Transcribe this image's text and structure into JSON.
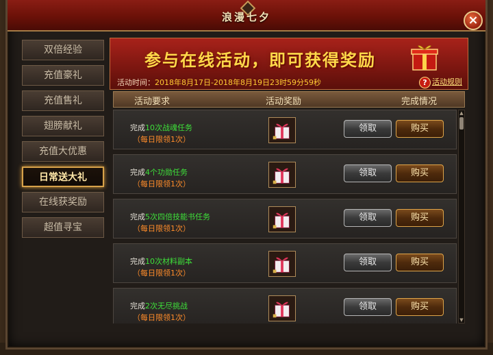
{
  "window": {
    "title": "浪漫七夕",
    "close_label": "×"
  },
  "sidebar": {
    "items": [
      {
        "label": "双倍经验"
      },
      {
        "label": "充值豪礼"
      },
      {
        "label": "充值售礼"
      },
      {
        "label": "翅膀献礼"
      },
      {
        "label": "充值大优惠"
      },
      {
        "label": "日常送大礼",
        "active": true
      },
      {
        "label": "在线获奖励"
      },
      {
        "label": "超值寻宝"
      }
    ]
  },
  "banner": {
    "title": "参与在线活动，即可获得奖励",
    "time_label": "活动时间：",
    "time_value": "2018年8月17日-2018年8月19日23时59分59秒",
    "rules_label": "活动规则",
    "help_symbol": "?"
  },
  "table": {
    "headers": [
      "活动要求",
      "活动奖励",
      "完成情况"
    ],
    "rows": [
      {
        "prefix": "完成",
        "task": "10次战魂任务",
        "limit": "（每日限领1次）",
        "claim": "领取",
        "buy": "购买"
      },
      {
        "prefix": "完成",
        "task": "4个功勋任务",
        "limit": "（每日限领1次）",
        "claim": "领取",
        "buy": "购买"
      },
      {
        "prefix": "完成",
        "task": "5次四倍技能书任务",
        "limit": "（每日限领1次）",
        "claim": "领取",
        "buy": "购买"
      },
      {
        "prefix": "完成",
        "task": "10次材料副本",
        "limit": "（每日限领1次）",
        "claim": "领取",
        "buy": "购买"
      },
      {
        "prefix": "完成",
        "task": "2次无尽挑战",
        "limit": "（每日限领1次）",
        "claim": "领取",
        "buy": "购买"
      }
    ]
  },
  "icons": {
    "gift": "gift-box-icon",
    "close": "close-icon",
    "help": "help-icon"
  },
  "colors": {
    "highlight_text": "#3ee03a",
    "limit_text": "#ff8c2a",
    "title_bar": "#6b1108",
    "accent_gold": "#d7a24a"
  }
}
